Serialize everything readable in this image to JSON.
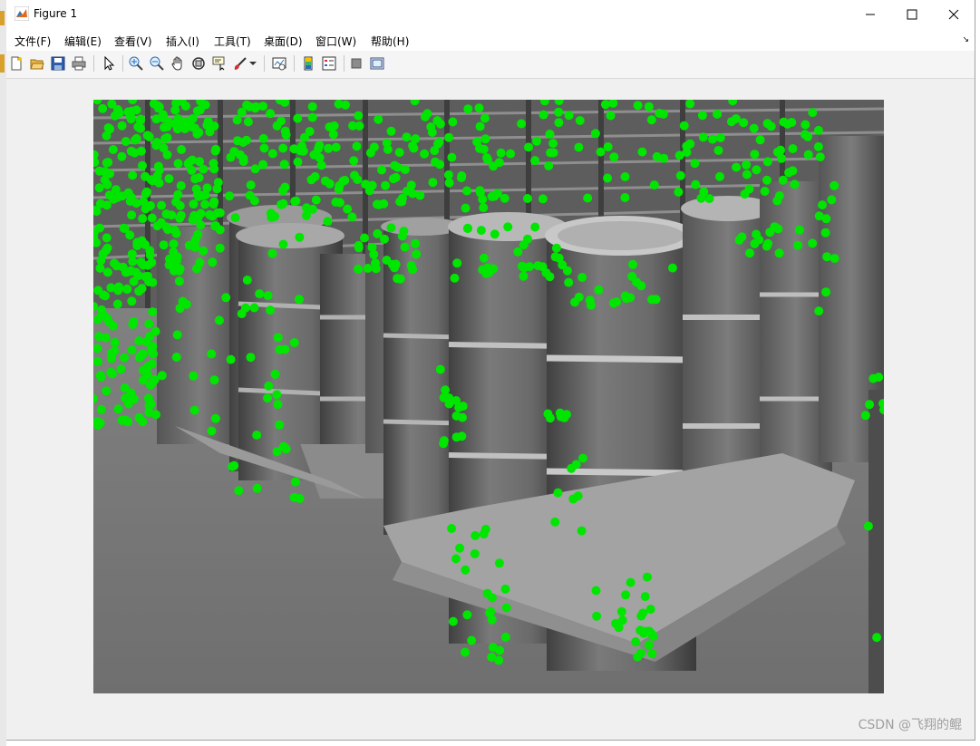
{
  "window": {
    "title": "Figure 1"
  },
  "menu": [
    {
      "label": "文件(F)"
    },
    {
      "label": "编辑(E)"
    },
    {
      "label": "查看(V)"
    },
    {
      "label": "插入(I)"
    },
    {
      "label": "工具(T)"
    },
    {
      "label": "桌面(D)"
    },
    {
      "label": "窗口(W)"
    },
    {
      "label": "帮助(H)"
    }
  ],
  "toolbar": {
    "icons": [
      "new-figure-icon",
      "open-file-icon",
      "save-icon",
      "print-icon",
      "select-arrow-icon",
      "zoom-in-icon",
      "zoom-out-icon",
      "pan-hand-icon",
      "rotate-3d-icon",
      "data-cursor-icon",
      "brush-icon",
      "brush-dropdown-icon",
      "link-plot-icon",
      "insert-colorbar-icon",
      "insert-legend-icon",
      "hide-plot-tools-icon",
      "show-plot-tools-icon"
    ]
  },
  "figure": {
    "image": "grayscale photo of stacked cable reels on wooden pallets in a warehouse",
    "marker_color": "#00e600"
  },
  "watermark": "CSDN @飞翔的鲲"
}
